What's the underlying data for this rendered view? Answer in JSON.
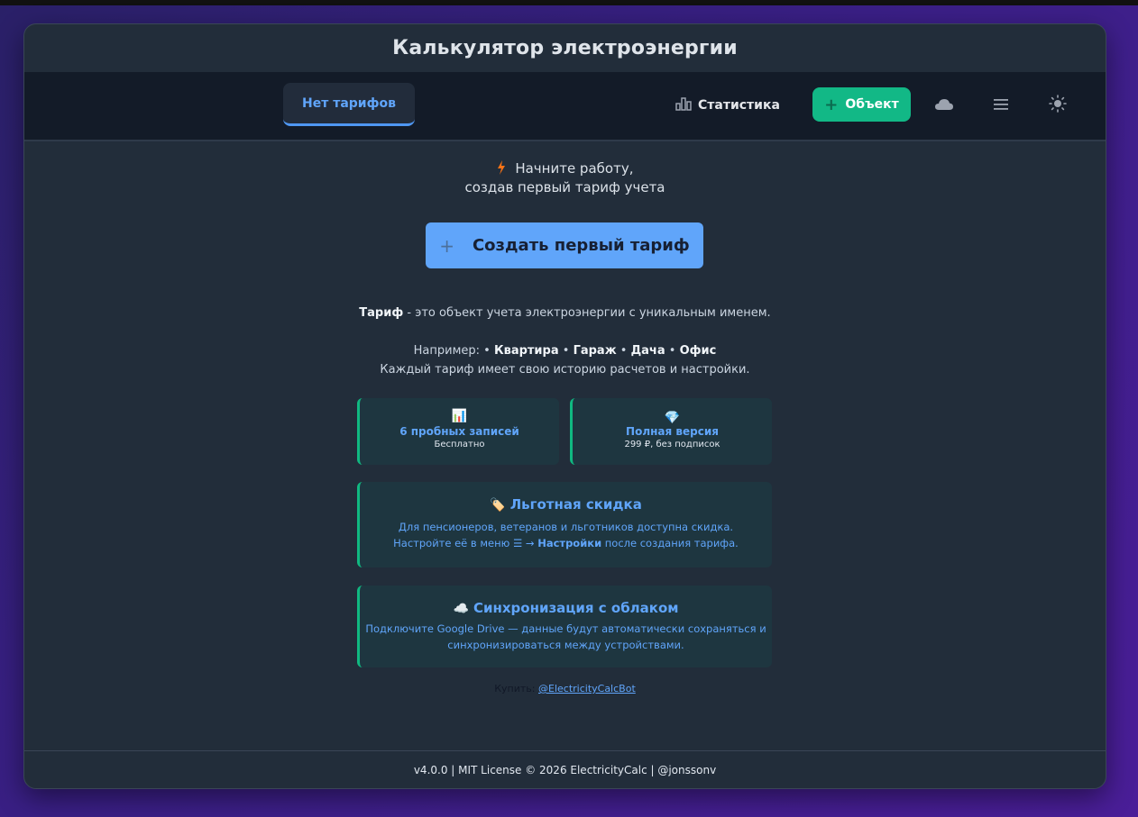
{
  "app": {
    "title": "Калькулятор электроэнергии"
  },
  "nav": {
    "tab_label": "Нет тарифов",
    "stats_label": "Статистика",
    "add_object_label": "Объект",
    "icons": [
      "chart-bar-icon",
      "plus-icon",
      "cloud-icon",
      "menu-icon",
      "sun-icon"
    ]
  },
  "intro": {
    "line1": "Начните работу,",
    "line2": "создав первый тариф учета"
  },
  "cta": {
    "label": "Создать первый тариф"
  },
  "description": {
    "term": "Тариф",
    "definition": " - это объект учета электроэнергии с уникальным именем.",
    "example_prefix": "Например: ",
    "examples": [
      "Квартира",
      "Гараж",
      "Дача",
      "Офис"
    ],
    "history_note": "Каждый тариф имеет свою историю расчетов и настройки."
  },
  "trial_card": {
    "icon": "📊",
    "title": "6 пробных записей",
    "subtitle": "Бесплатно"
  },
  "full_card": {
    "icon": "💎",
    "title": "Полная версия",
    "subtitle": "299 ₽, без подписок"
  },
  "discount_card": {
    "icon": "🏷️",
    "title": "Льготная скидка",
    "line1": "Для пенсионеров, ветеранов и льготников доступна скидка.",
    "line2_prefix": "Настройте её в меню ☰ → ",
    "line2_bold": "Настройки",
    "line2_suffix": " после создания тарифа."
  },
  "sync_card": {
    "icon": "☁️",
    "title": "Синхронизация с облаком",
    "line1": "Подключите Google Drive — данные будут автоматически сохраняться и",
    "line2": "синхронизироваться между устройствами."
  },
  "buy": {
    "label": "Купить: ",
    "link": "@ElectricityCalcBot"
  },
  "footer": {
    "text": "v4.0.0 | MIT License © 2026 ElectricityCalc | @jonssonv"
  },
  "colors": {
    "accent": "#60a5fa",
    "green": "#12b886",
    "bolt": "#f97316"
  }
}
